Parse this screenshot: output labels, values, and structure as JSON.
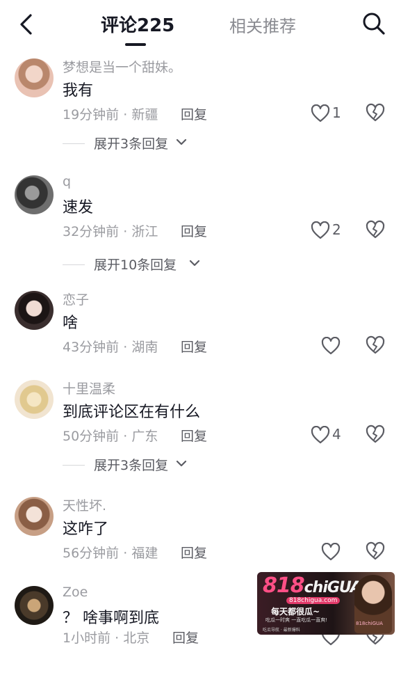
{
  "header": {
    "tab_comments": "评论225",
    "tab_related": "相关推荐"
  },
  "comments": [
    {
      "username": "梦想是当一个甜妹。",
      "text": "我有",
      "time": "19分钟前",
      "location": "新疆",
      "reply": "回复",
      "likes": "1",
      "expand": "展开3条回复"
    },
    {
      "username": "q",
      "text": "速发",
      "time": "32分钟前",
      "location": "浙江",
      "reply": "回复",
      "likes": "2",
      "expand": "展开10条回复"
    },
    {
      "username": "恋子",
      "text": "啥",
      "time": "43分钟前",
      "location": "湖南",
      "reply": "回复",
      "likes": "",
      "expand": ""
    },
    {
      "username": "十里温柔",
      "text": "到底评论区在有什么",
      "time": "50分钟前",
      "location": "广东",
      "reply": "回复",
      "likes": "4",
      "expand": "展开3条回复"
    },
    {
      "username": "天性坏.",
      "text": "这咋了",
      "time": "56分钟前",
      "location": "福建",
      "reply": "回复",
      "likes": "",
      "expand": ""
    },
    {
      "username": "Zoe",
      "text": "？ 啥事啊到底",
      "time": "1小时前",
      "location": "北京",
      "reply": "回复",
      "likes": "",
      "expand": ""
    }
  ],
  "separator": " · ",
  "watermark": {
    "logo_num": "818",
    "logo_text": "chiGUA",
    "url": "818chigua.com",
    "slogan": "每天都很瓜~",
    "sub": "吃瓜一时爽 一直吃瓜一直爽!",
    "brand": "818chiGUA",
    "bottom": "吃瓜导航 · 最新爆料"
  }
}
